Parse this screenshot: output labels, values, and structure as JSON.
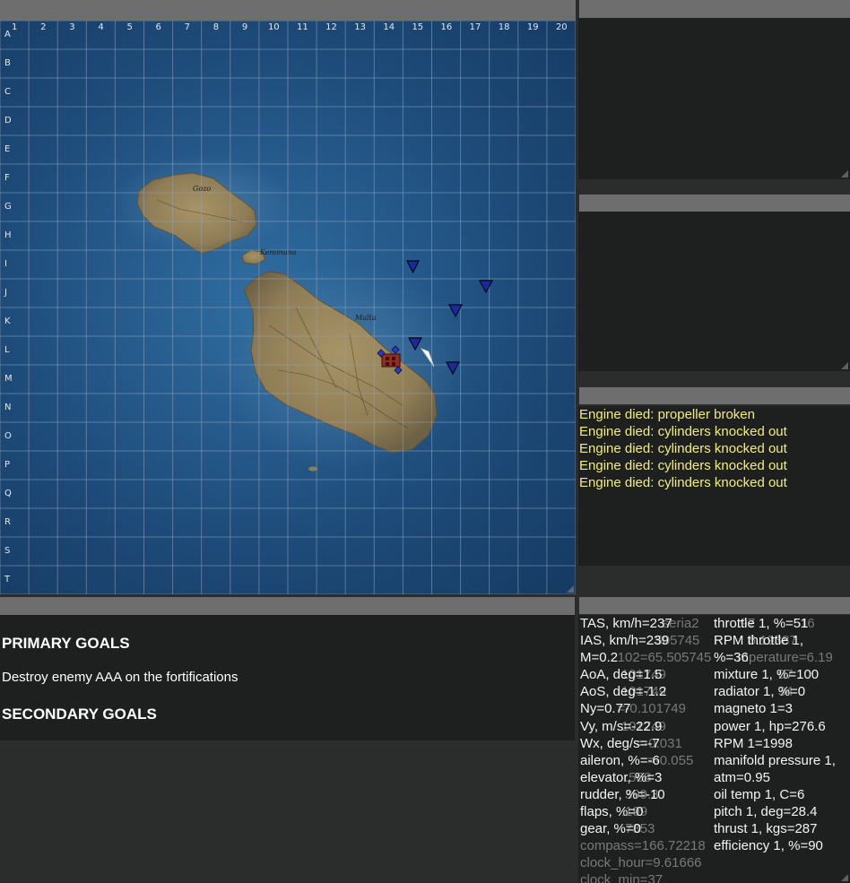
{
  "map": {
    "columns": [
      "1",
      "2",
      "3",
      "4",
      "5",
      "6",
      "7",
      "8",
      "9",
      "10",
      "11",
      "12",
      "13",
      "14",
      "15",
      "16",
      "17",
      "18",
      "19",
      "20"
    ],
    "rows": [
      "A",
      "B",
      "C",
      "D",
      "E",
      "F",
      "G",
      "H",
      "I",
      "J",
      "K",
      "L",
      "M",
      "N",
      "O",
      "P",
      "Q",
      "R",
      "S",
      "T"
    ],
    "places": [
      "Gozo",
      "Kemmuna",
      "Malta"
    ],
    "markers": [
      "enemy-ship",
      "enemy-ship",
      "enemy-ship",
      "enemy-ship",
      "enemy-ship",
      "player-aircraft",
      "target-fortification"
    ],
    "colors": {
      "sea": "#1d4a78",
      "land": "#9c8a62",
      "grid": "#7f93a8",
      "marker": "#1b2a9a",
      "player": "#ffffff",
      "target": "#9a2a1f"
    }
  },
  "log": {
    "lines": [
      "Engine died: propeller broken",
      "Engine died: cylinders knocked out",
      "Engine died: cylinders knocked out",
      "Engine died: cylinders knocked out",
      "Engine died: cylinders knocked out"
    ]
  },
  "goals": {
    "primary_heading": "PRIMARY GOALS",
    "primary_text": "Destroy enemy AAA on the fortifications",
    "secondary_heading": "SECONDARY GOALS"
  },
  "telemetry": {
    "left": [
      "TAS, km/h=237",
      "IAS, km/h=239",
      "M=0.2",
      "AoA, deg=1.5",
      "AoS, deg=-1.2",
      "Ny=0.77",
      "Vy, m/s=-22.9",
      "Wx, deg/s=-7",
      "aileron, %=-6",
      "elevator, %=3",
      "rudder, %=-10",
      "flaps, %=0",
      "gear, %=0"
    ],
    "right": [
      "throttle 1, %=51",
      "RPM throttle 1,",
      "%=36",
      "mixture 1, %=100",
      "radiator 1, %=0",
      "magneto 1=3",
      "power 1, hp=276.6",
      "RPM 1=1998",
      "manifold pressure 1,",
      "atm=0.95",
      "oil temp 1, C=6",
      "pitch 1, deg=28.4",
      "thrust 1, kgs=287",
      "efficiency 1, %=90"
    ],
    "ghost": [
      "                      seria2          .97            16",
      "                   .505745             6.19387",
      "          102=65.505745       mperature=6.19",
      "          .101749                              07",
      "          .101749                              34",
      "          =-0.101749",
      "          .101749",
      "               =-0.031",
      "                  =-0.055",
      "            .568",
      "            399.3",
      "           .199",
      "           .7853",
      "compass=166.72218",
      "clock_hour=9.61666",
      "clock_min=37"
    ]
  }
}
